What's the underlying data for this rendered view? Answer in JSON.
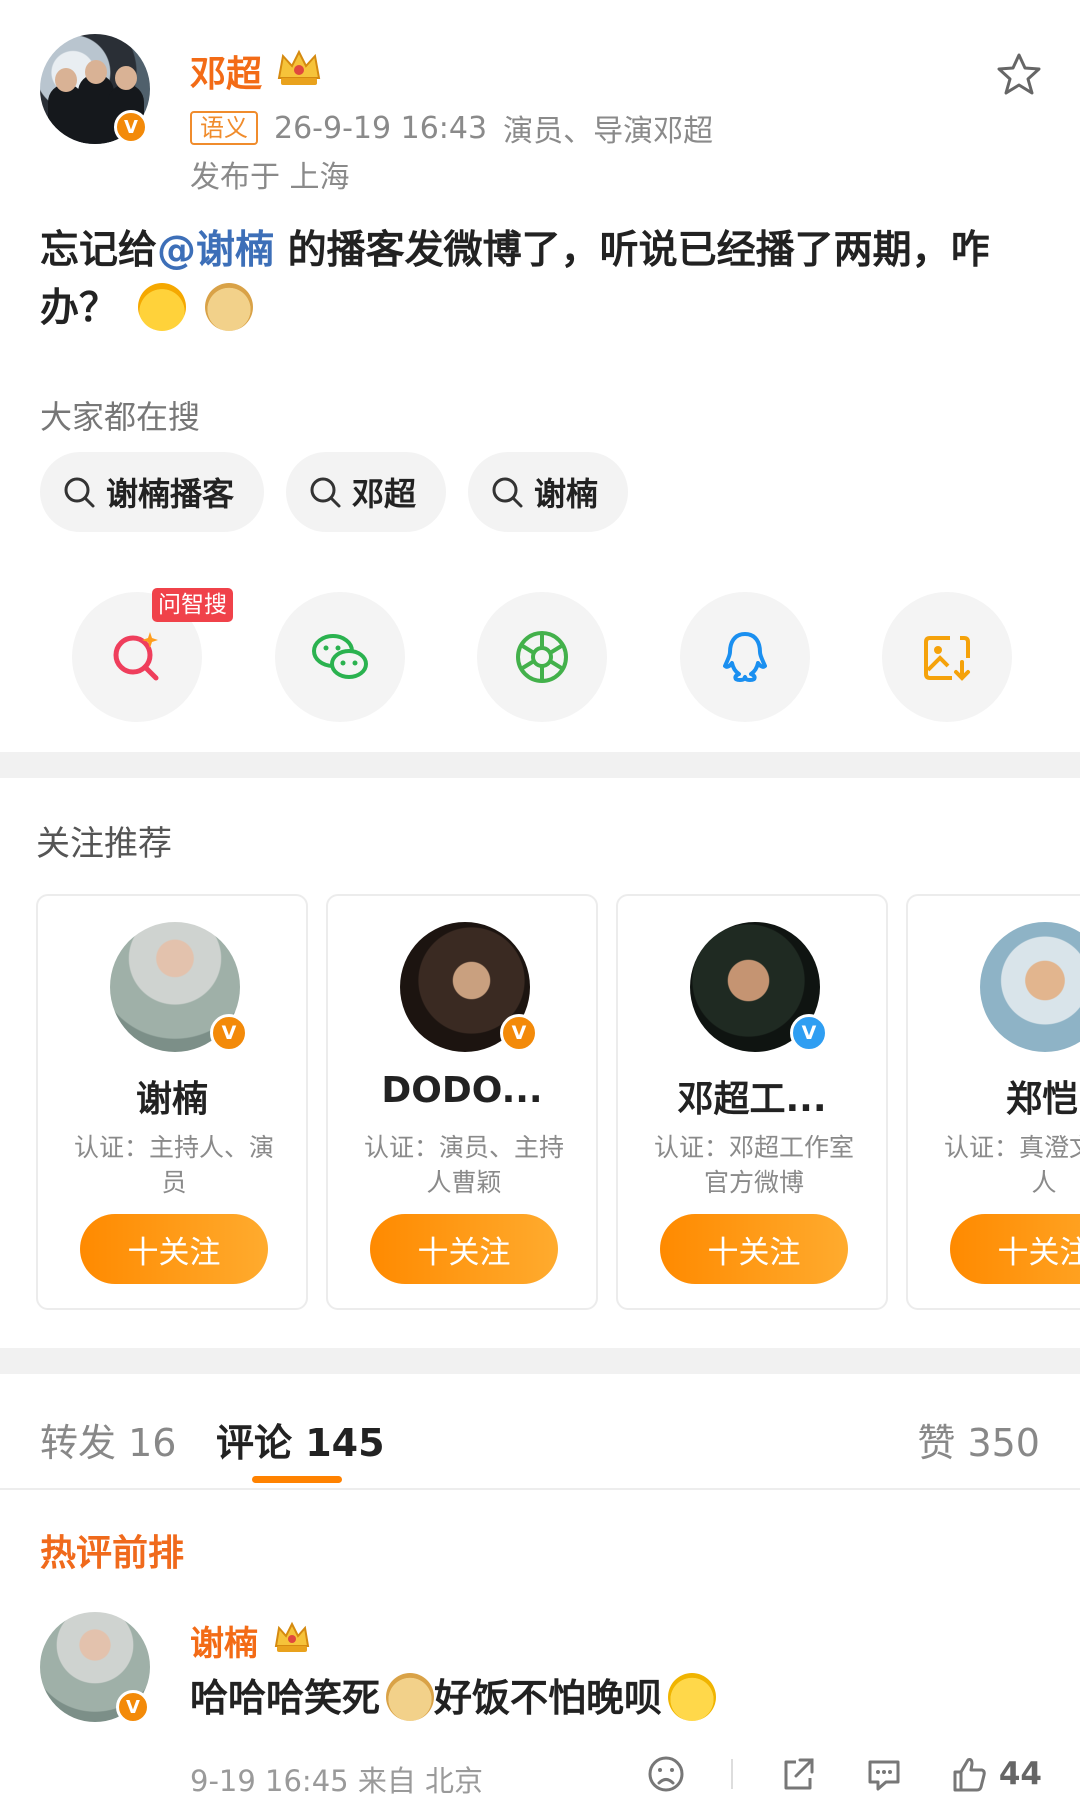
{
  "post": {
    "author": "邓超",
    "tag": "语义",
    "time": "26-9-19 16:43",
    "source": "演员、导演邓超",
    "location": "发布于 上海",
    "text_before": "忘记给",
    "mention": "@谢楠",
    "text_after": " 的播客发微博了，听说已经播了两期，咋办？"
  },
  "search": {
    "title": "大家都在搜",
    "chips": [
      "谢楠播客",
      "邓超",
      "谢楠"
    ]
  },
  "share": {
    "ask_badge": "问智搜"
  },
  "recommend": {
    "title": "关注推荐",
    "cards": [
      {
        "name": "谢楠",
        "desc": "认证：主持人、演员",
        "follow": "十关注"
      },
      {
        "name": "DODO...",
        "desc": "认证：演员、主持人曹颖",
        "follow": "十关注"
      },
      {
        "name": "邓超工...",
        "desc": "认证：邓超工作室官方微博",
        "follow": "十关注"
      },
      {
        "name": "郑恺",
        "desc": "认证：真澄文下艺人",
        "follow": "十关注"
      }
    ]
  },
  "tabs": {
    "repost": "转发 16",
    "comment": "评论 145",
    "like": "赞 350"
  },
  "comments": {
    "section_title": "热评前排",
    "items": [
      {
        "name": "谢楠",
        "text_before": "哈哈哈笑死",
        "text_after": "好饭不怕晚呗",
        "meta": "9-19 16:45 来自 北京",
        "likes": "44"
      }
    ]
  },
  "colors": {
    "brand_orange": "#ff8200",
    "name_orange": "#f36b16",
    "mention_blue": "#3d6fb8",
    "verified_orange": "#f38a09",
    "verified_blue": "#2f9ef2"
  }
}
